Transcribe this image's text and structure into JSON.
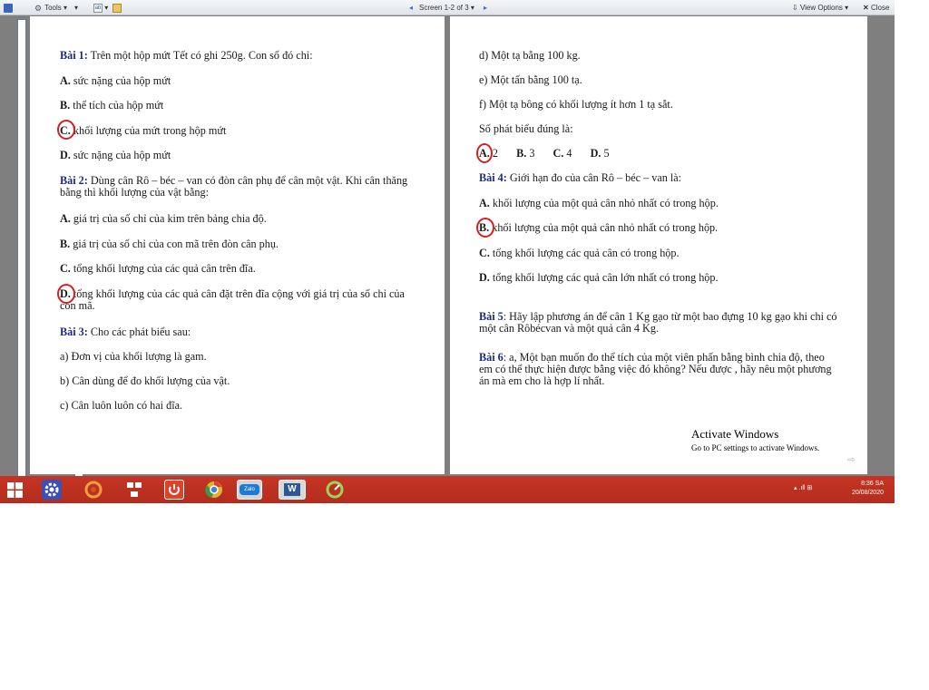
{
  "toolbar": {
    "tools_label": "Tools",
    "screen_label": "Screen 1-2 of 3",
    "view_options_label": "View Options",
    "close_label": "Close"
  },
  "page_left": {
    "b1_label": "Bài 1:",
    "b1_text": "Trên một hộp mứt Tết có ghi 250g. Con số đó chỉ:",
    "b1_a_letter": "A.",
    "b1_a_text": "sức nặng của hộp mứt",
    "b1_b_letter": "B.",
    "b1_b_text": "thể tích của hộp mứt",
    "b1_c_letter": "C.",
    "b1_c_text": "khối lượng của mứt trong hộp mứt",
    "b1_d_letter": "D.",
    "b1_d_text": "sức nặng của hộp mứt",
    "b2_label": "Bài 2:",
    "b2_text": "Dùng cân Rô – béc – van có đòn cân phụ để cân một vật. Khi cân thăng bằng thì khối lượng của vật bằng:",
    "b2_a_letter": "A.",
    "b2_a_text": "giá trị của số chỉ của kim trên bảng chia độ.",
    "b2_b_letter": "B.",
    "b2_b_text": "giá trị của số chỉ của con mã trên đòn cân phụ.",
    "b2_c_letter": "C.",
    "b2_c_text": "tổng khối lượng của các quả cân trên đĩa.",
    "b2_d_letter": "D.",
    "b2_d_text": "tổng khối lượng của các quả cân đặt trên đĩa cộng với giá trị của số chỉ của con mã.",
    "b3_label": "Bài 3:",
    "b3_text": "Cho các phát biểu sau:",
    "b3_a": "a) Đơn vị của khối lượng là gam.",
    "b3_b": "b) Cân dùng để đo khối lượng của vật.",
    "b3_c": "c) Cân luôn luôn có hai đĩa."
  },
  "page_right": {
    "d": "d) Một tạ bằng 100 kg.",
    "e": "e) Một tấn bằng 100 tạ.",
    "f": "f) Một tạ bông có khối lượng ít hơn 1 tạ sắt.",
    "count_q": "Số phát biểu đúng là:",
    "opt_a_letter": "A.",
    "opt_a_val": "2",
    "opt_b_letter": "B.",
    "opt_b_val": "3",
    "opt_c_letter": "C.",
    "opt_c_val": "4",
    "opt_d_letter": "D.",
    "opt_d_val": "5",
    "b4_label": "Bài 4:",
    "b4_text": "Giới hạn đo của cân Rô – béc – van là:",
    "b4_a_letter": "A.",
    "b4_a_text": "khối lượng của một quả cân nhỏ nhất có trong hộp.",
    "b4_b_letter": "B.",
    "b4_b_text": "khối lượng của một quả cân nhỏ nhất có trong hộp.",
    "b4_c_letter": "C.",
    "b4_c_text": "tổng khối lượng các quả cân có trong hộp.",
    "b4_d_letter": "D.",
    "b4_d_text": "tổng khối lượng các quả cân lớn nhất có trong hộp.",
    "b5_label": "Bài 5",
    "b5_text": ": Hãy lập phương án để cân 1 Kg gạo từ một bao đựng 10 kg gạo khi chỉ có một cân Rôbécvan và một quả cân 4 Kg.",
    "b6_label": "Bài 6",
    "b6_text": ": a, Một bạn muốn đo thể tích của một viên phấn bằng bình chia độ, theo em có thể thực hiện được bằng việc đó không? Nếu được , hãy nêu một phương án mà em cho là hợp lí nhất."
  },
  "watermark": {
    "line1": "Activate Windows",
    "line2": "Go to PC settings to activate Windows."
  },
  "taskbar": {
    "zalo_label": "Zalo",
    "word_label": "W",
    "time": "8:36 SA",
    "date": "20/08/2020"
  },
  "colors": {
    "taskbar": "#c0392b",
    "annotation_circle": "#d42020",
    "heading_blue": "#1a2a8c"
  }
}
